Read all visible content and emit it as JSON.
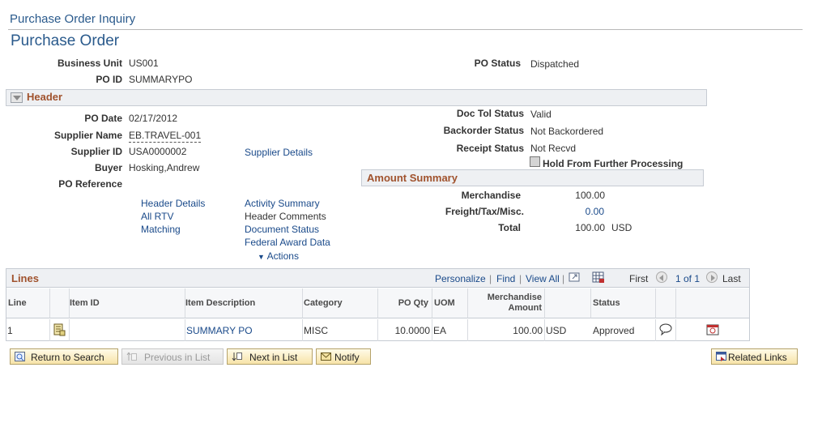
{
  "breadcrumb": "Purchase Order Inquiry",
  "page_title": "Purchase Order",
  "top": {
    "business_unit_label": "Business Unit",
    "business_unit": "US001",
    "po_id_label": "PO ID",
    "po_id": "SUMMARYPO",
    "po_status_label": "PO Status",
    "po_status": "Dispatched"
  },
  "header": {
    "title": "Header",
    "po_date_label": "PO Date",
    "po_date": "02/17/2012",
    "supplier_name_label": "Supplier Name",
    "supplier_name": "EB.TRAVEL-001",
    "supplier_id_label": "Supplier ID",
    "supplier_id": "USA0000002",
    "supplier_details": "Supplier Details",
    "buyer_label": "Buyer",
    "buyer": "Hosking,Andrew",
    "po_reference_label": "PO Reference",
    "doc_tol_label": "Doc Tol Status",
    "doc_tol": "Valid",
    "backorder_label": "Backorder Status",
    "backorder": "Not Backordered",
    "receipt_label": "Receipt Status",
    "receipt": "Not Recvd",
    "hold_label": "Hold From Further Processing",
    "links": {
      "header_details": "Header Details",
      "all_rtv": "All RTV",
      "matching": "Matching",
      "activity_summary": "Activity Summary",
      "header_comments": "Header Comments",
      "document_status": "Document Status",
      "federal_award": "Federal Award Data",
      "actions": "Actions"
    }
  },
  "amount_summary": {
    "title": "Amount Summary",
    "merchandise_label": "Merchandise",
    "merchandise": "100.00",
    "freight_label": "Freight/Tax/Misc.",
    "freight": "0.00",
    "total_label": "Total",
    "total": "100.00",
    "currency": "USD"
  },
  "lines": {
    "title": "Lines",
    "personalize": "Personalize",
    "find": "Find",
    "view_all": "View All",
    "first": "First",
    "range": "1 of 1",
    "last": "Last",
    "columns": {
      "line": "Line",
      "item_id": "Item ID",
      "item_desc": "Item Description",
      "category": "Category",
      "po_qty": "PO Qty",
      "uom": "UOM",
      "merch_amount_1": "Merchandise",
      "merch_amount_2": "Amount",
      "status": "Status"
    },
    "rows": [
      {
        "line": "1",
        "item_id": "",
        "item_desc": "SUMMARY PO",
        "category": "MISC",
        "po_qty": "10.0000",
        "uom": "EA",
        "amount": "100.00",
        "currency": "USD",
        "status": "Approved"
      }
    ]
  },
  "buttons": {
    "return_to_search": "Return to Search",
    "previous_in_list": "Previous in List",
    "next_in_list": "Next in List",
    "notify": "Notify",
    "related_links": "Related Links"
  }
}
